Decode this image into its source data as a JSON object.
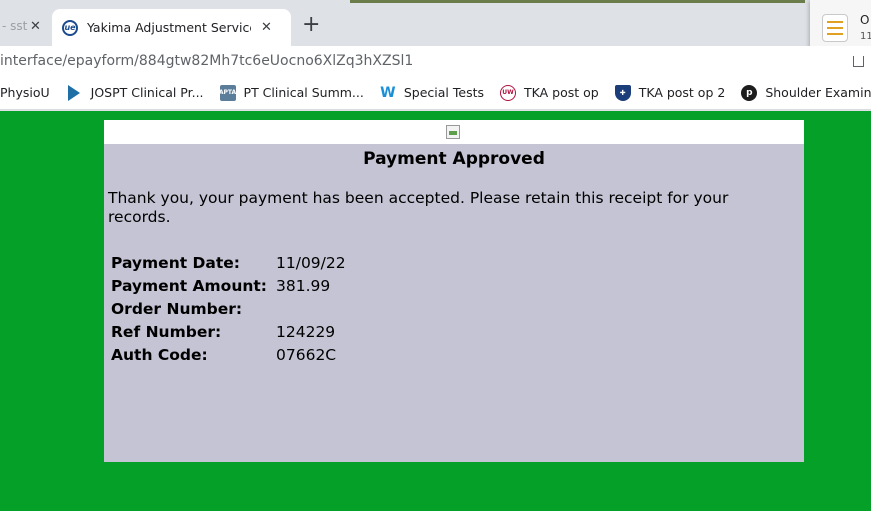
{
  "browser": {
    "tabs": [
      {
        "title": "- sst",
        "active": false
      },
      {
        "title": "Yakima Adjustment Services In",
        "active": true
      }
    ],
    "new_tab_label": "+",
    "close_glyph": "✕",
    "url": "interface/epayform/884gtw82Mh7tc6eUocno6XlZq3hXZSl1",
    "notification": {
      "line1": "O",
      "line2": "11"
    },
    "bookmarks": [
      {
        "label": "PhysioU",
        "icon": "none"
      },
      {
        "label": "JOSPT Clinical Pr...",
        "icon": "jospt-icon"
      },
      {
        "label": "PT Clinical Summ...",
        "icon": "apta-icon"
      },
      {
        "label": "Special Tests",
        "icon": "w-icon"
      },
      {
        "label": "TKA post op",
        "icon": "uw-icon"
      },
      {
        "label": "TKA post op 2",
        "icon": "shield-icon"
      },
      {
        "label": "Shoulder Examina...",
        "icon": "p-icon"
      }
    ]
  },
  "page": {
    "background_color": "#04a028",
    "panel_color": "#c4c4d4",
    "title": "Payment Approved",
    "message": "Thank you, your payment has been accepted. Please retain this receipt for your records.",
    "details": [
      {
        "label": "Payment Date:",
        "value": "11/09/22"
      },
      {
        "label": "Payment Amount:",
        "value": "381.99"
      },
      {
        "label": "Order Number:",
        "value": ""
      },
      {
        "label": "Ref Number:",
        "value": "124229"
      },
      {
        "label": "Auth Code:",
        "value": "07662C"
      }
    ]
  }
}
